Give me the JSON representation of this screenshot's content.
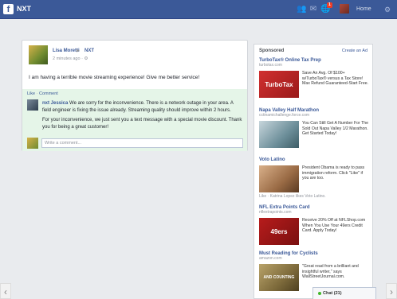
{
  "topbar": {
    "logo": "f",
    "title": "NXT",
    "notification_count": "1",
    "home_label": "Home"
  },
  "post": {
    "author": "Lisa Moretti",
    "target": "NXT",
    "time": "2 minutes ago · ",
    "text": "I am having a terrible movie streaming experience! Give me better service!",
    "actions": {
      "like": "Like",
      "sep": " · ",
      "comment": "Comment"
    },
    "reply_author": "nxt Jessica",
    "reply_p1": " We are sorry for the inconvenience. There is a network outage in your area. A field engineer is fixing the issue already. Streaming quality should improve within 2 hours.",
    "reply_p2": "For your inconvenience, we just sent you a text message with a special movie discount. Thank you for being a great customer!",
    "comment_placeholder": "Write a comment..."
  },
  "sidebar": {
    "sponsored": "Sponsored",
    "create_ad": "Create an Ad",
    "ads": [
      {
        "title": "TurboTax® Online Tax Prep",
        "url": "turbotax.com",
        "image_label": "TurboTax",
        "text": "Save An Avg. Of $100+ w/TurboTax® versus a Tax Store! Max Refund Guaranteed-Start Free."
      },
      {
        "title": "Napa Valley Half Marathon",
        "url": "cctinamichallenge.force.com",
        "image_label": "",
        "text": "You Can Still Get A Number For The Sold Out Napa Valley 1/2 Marathon. Get Started Today!"
      },
      {
        "title": "Voto Latino",
        "url": "",
        "image_label": "",
        "text": "President Obama is ready to pass immigration reform. Click \"Like\" if you are too.",
        "like": "Like · Katrina Lopez likes Voto Latino."
      },
      {
        "title": "NFL Extra Points Card",
        "url": "nflextrapoints.com",
        "image_label": "49ers",
        "text": "Receive 20% Off at NFLShop.com When You Use Your 49ers Credit Card. Apply Today!"
      },
      {
        "title": "Must Reading for Cyclists",
        "url": "amazon.com",
        "image_label": "AND COUNTING",
        "text": "\"Great read from a brilliant and insightful writer,\" says WallStreetJournal.com."
      }
    ]
  },
  "chat": {
    "label": "Chat (21)"
  }
}
